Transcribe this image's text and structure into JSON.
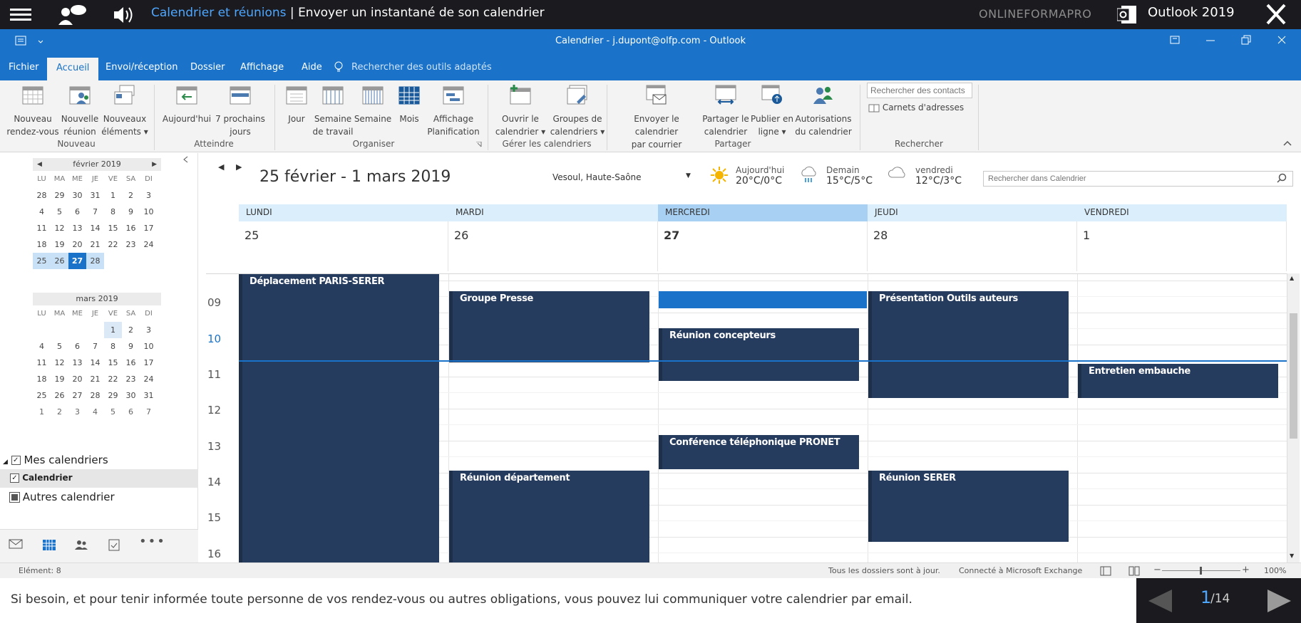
{
  "topbar": {
    "crumb_section": "Calendrier et réunions",
    "crumb_sep": " | ",
    "crumb_page": "Envoyer un instantané de son calendrier",
    "org": "ONLINEFORMAPRO",
    "product": "Outlook 2019"
  },
  "titlebar": {
    "title": "Calendrier - j.dupont@olfp.com - Outlook"
  },
  "menu": {
    "items": [
      "Fichier",
      "Accueil",
      "Envoi/réception",
      "Dossier",
      "Affichage",
      "Aide"
    ],
    "tell_me": "Rechercher des outils adaptés"
  },
  "ribbon": {
    "buttons": [
      {
        "l1": "Nouveau",
        "l2": "rendez-vous"
      },
      {
        "l1": "Nouvelle",
        "l2": "réunion"
      },
      {
        "l1": "Nouveaux",
        "l2": "éléments ▾"
      },
      {
        "l1": "Aujourd'hui",
        "l2": ""
      },
      {
        "l1": "7 prochains",
        "l2": "jours"
      },
      {
        "l1": "Jour",
        "l2": ""
      },
      {
        "l1": "Semaine",
        "l2": "de travail"
      },
      {
        "l1": "Semaine",
        "l2": ""
      },
      {
        "l1": "Mois",
        "l2": ""
      },
      {
        "l1": "Affichage",
        "l2": "Planification"
      },
      {
        "l1": "Ouvrir le",
        "l2": "calendrier ▾"
      },
      {
        "l1": "Groupes de",
        "l2": "calendriers ▾"
      },
      {
        "l1": "Envoyer le calendrier",
        "l2": "par courrier"
      },
      {
        "l1": "Partager le",
        "l2": "calendrier"
      },
      {
        "l1": "Publier en",
        "l2": "ligne ▾"
      },
      {
        "l1": "Autorisations",
        "l2": "du calendrier"
      }
    ],
    "groups": [
      "Nouveau",
      "Atteindre",
      "Organiser",
      "Gérer les calendriers",
      "Partager",
      "Rechercher"
    ],
    "search_contacts": "Rechercher des contacts",
    "address_books": "Carnets d'adresses"
  },
  "minical": {
    "feb": {
      "title": "février 2019",
      "dow": [
        "LU",
        "MA",
        "ME",
        "JE",
        "VE",
        "SA",
        "DI"
      ],
      "weeks": [
        [
          "28",
          "29",
          "30",
          "31",
          "1",
          "2",
          "3"
        ],
        [
          "4",
          "5",
          "6",
          "7",
          "8",
          "9",
          "10"
        ],
        [
          "11",
          "12",
          "13",
          "14",
          "15",
          "16",
          "17"
        ],
        [
          "18",
          "19",
          "20",
          "21",
          "22",
          "23",
          "24"
        ],
        [
          "25",
          "26",
          "27",
          "28",
          "",
          "",
          ""
        ]
      ]
    },
    "mar": {
      "title": "mars 2019",
      "dow": [
        "LU",
        "MA",
        "ME",
        "JE",
        "VE",
        "SA",
        "DI"
      ],
      "weeks": [
        [
          "",
          "",
          "",
          "",
          "1",
          "2",
          "3"
        ],
        [
          "4",
          "5",
          "6",
          "7",
          "8",
          "9",
          "10"
        ],
        [
          "11",
          "12",
          "13",
          "14",
          "15",
          "16",
          "17"
        ],
        [
          "18",
          "19",
          "20",
          "21",
          "22",
          "23",
          "24"
        ],
        [
          "25",
          "26",
          "27",
          "28",
          "29",
          "30",
          "31"
        ],
        [
          "1",
          "2",
          "3",
          "4",
          "5",
          "6",
          "7"
        ]
      ]
    }
  },
  "calendars": {
    "group": "Mes calendriers",
    "item": "Calendrier",
    "other": "Autres calendrier"
  },
  "calendar": {
    "range": "25 février - 1 mars 2019",
    "location": "Vesoul, Haute-Saône",
    "weather": [
      {
        "day": "Aujourd'hui",
        "temp": "20°C/0°C"
      },
      {
        "day": "Demain",
        "temp": "15°C/5°C"
      },
      {
        "day": "vendredi",
        "temp": "12°C/3°C"
      }
    ],
    "search_placeholder": "Rechercher dans Calendrier",
    "days": [
      {
        "name": "LUNDI",
        "num": "25"
      },
      {
        "name": "MARDI",
        "num": "26"
      },
      {
        "name": "MERCREDI",
        "num": "27"
      },
      {
        "name": "JEUDI",
        "num": "28"
      },
      {
        "name": "VENDREDI",
        "num": "1"
      }
    ],
    "hours": [
      "09",
      "10",
      "11",
      "12",
      "13",
      "14",
      "15",
      "16"
    ],
    "events": [
      {
        "title": "Déplacement PARIS-SERER"
      },
      {
        "title": "Groupe Presse"
      },
      {
        "title": "Réunion concepteurs"
      },
      {
        "title": "Présentation Outils auteurs"
      },
      {
        "title": "Entretien embauche"
      },
      {
        "title": "Conférence téléphonique PRONET"
      },
      {
        "title": "Réunion département"
      },
      {
        "title": "Réunion SERER"
      }
    ]
  },
  "status": {
    "items": "Elément: 8",
    "sync": "Tous les dossiers sont à jour.",
    "connection": "Connecté à Microsoft Exchange",
    "zoom": "100%"
  },
  "footer": {
    "instruction": "Si besoin, et pour tenir informée toute personne de vos rendez-vous ou autres obligations, vous pouvez lui communiquer votre calendrier par email.",
    "page_current": "1",
    "page_total": "/14"
  },
  "colors": {
    "accent": "#1a73c9",
    "event": "#263c5e",
    "topbar": "#1b1b1f"
  }
}
